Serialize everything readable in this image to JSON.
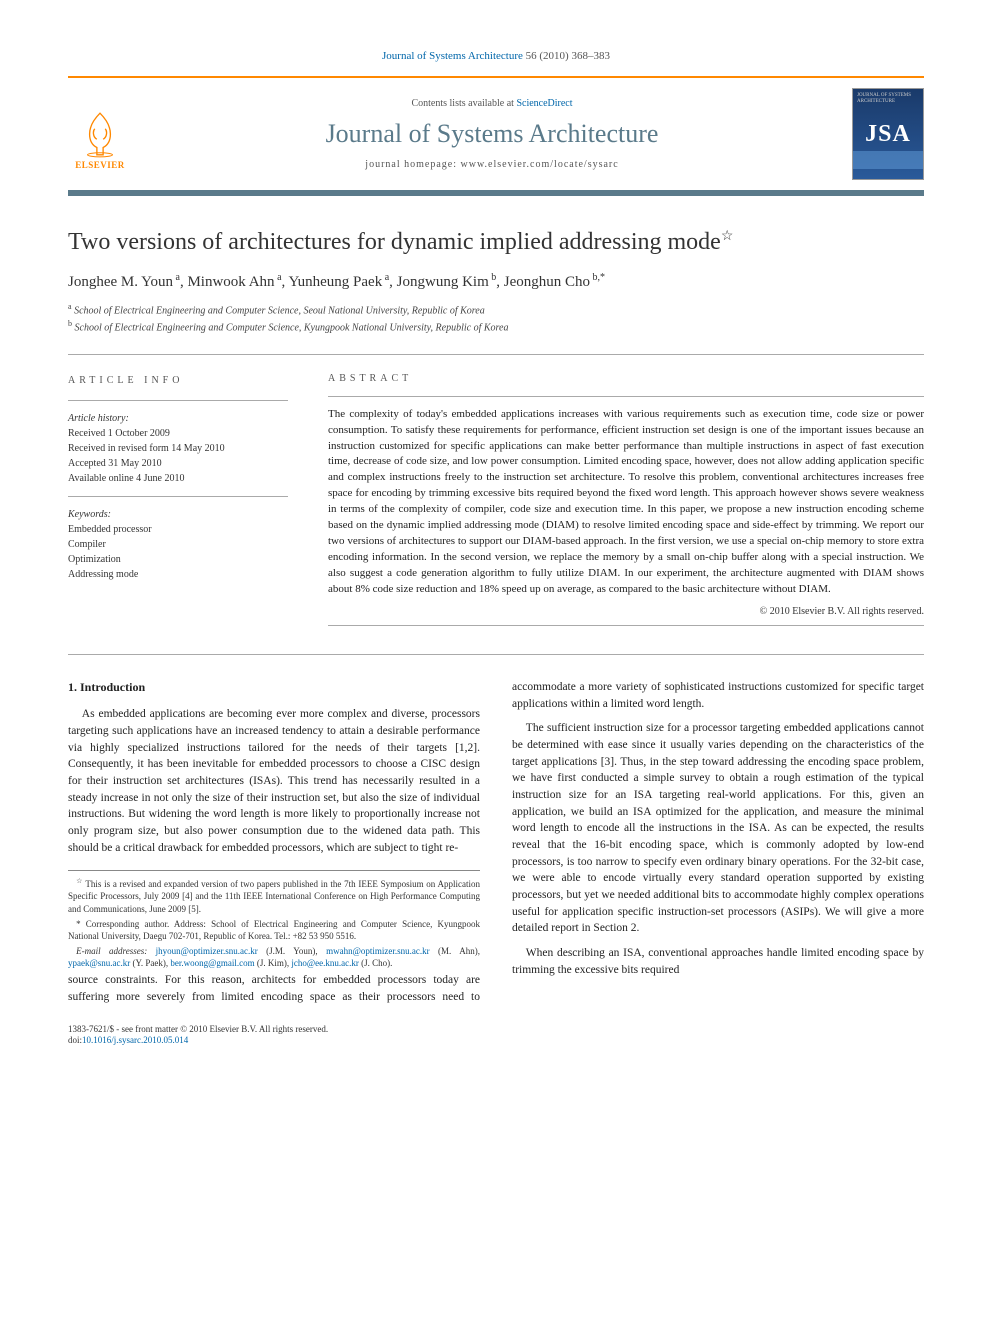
{
  "top_citation": {
    "journal_link": "Journal of Systems Architecture",
    "vol_pages": " 56 (2010) 368–383"
  },
  "mast": {
    "contents_prefix": "Contents lists available at ",
    "contents_link": "ScienceDirect",
    "journal_name": "Journal of Systems Architecture",
    "homepage_prefix": "journal homepage: ",
    "homepage_url": "www.elsevier.com/locate/sysarc",
    "logo_text": "ELSEVIER",
    "cover_label": "JSA",
    "cover_top": "JOURNAL OF SYSTEMS ARCHITECTURE"
  },
  "title": "Two versions of architectures for dynamic implied addressing mode",
  "title_star": "☆",
  "authors_html": "Jonghee M. Youn ᵃ, Minwook Ahn ᵃ, Yunheung Paek ᵃ, Jongwung Kim ᵇ, Jeonghun Cho ᵇ,*",
  "affils": {
    "a": "School of Electrical Engineering and Computer Science, Seoul National University, Republic of Korea",
    "b": "School of Electrical Engineering and Computer Science, Kyungpook National University, Republic of Korea"
  },
  "info": {
    "heading": "ARTICLE INFO",
    "history_label": "Article history:",
    "received": "Received 1 October 2009",
    "revised": "Received in revised form 14 May 2010",
    "accepted": "Accepted 31 May 2010",
    "online": "Available online 4 June 2010",
    "keywords_label": "Keywords:",
    "keywords": [
      "Embedded processor",
      "Compiler",
      "Optimization",
      "Addressing mode"
    ]
  },
  "abstract": {
    "heading": "ABSTRACT",
    "text": "The complexity of today's embedded applications increases with various requirements such as execution time, code size or power consumption. To satisfy these requirements for performance, efficient instruction set design is one of the important issues because an instruction customized for specific applications can make better performance than multiple instructions in aspect of fast execution time, decrease of code size, and low power consumption. Limited encoding space, however, does not allow adding application specific and complex instructions freely to the instruction set architecture. To resolve this problem, conventional architectures increases free space for encoding by trimming excessive bits required beyond the fixed word length. This approach however shows severe weakness in terms of the complexity of compiler, code size and execution time. In this paper, we propose a new instruction encoding scheme based on the dynamic implied addressing mode (DIAM) to resolve limited encoding space and side-effect by trimming. We report our two versions of architectures to support our DIAM-based approach. In the first version, we use a special on-chip memory to store extra encoding information. In the second version, we replace the memory by a small on-chip buffer along with a special instruction. We also suggest a code generation algorithm to fully utilize DIAM. In our experiment, the architecture augmented with DIAM shows about 8% code size reduction and 18% speed up on average, as compared to the basic architecture without DIAM.",
    "copyright": "© 2010 Elsevier B.V. All rights reserved."
  },
  "body": {
    "section_heading": "1. Introduction",
    "p1": "As embedded applications are becoming ever more complex and diverse, processors targeting such applications have an increased tendency to attain a desirable performance via highly specialized instructions tailored for the needs of their targets [1,2]. Consequently, it has been inevitable for embedded processors to choose a CISC design for their instruction set architectures (ISAs). This trend has necessarily resulted in a steady increase in not only the size of their instruction set, but also the size of individual instructions. But widening the word length is more likely to proportionally increase not only program size, but also power consumption due to the widened data path. This should be a critical drawback for embedded processors, which are subject to tight re-",
    "p2": "source constraints. For this reason, architects for embedded processors today are suffering more severely from limited encoding space as their processors need to accommodate a more variety of sophisticated instructions customized for specific target applications within a limited word length.",
    "p3": "The sufficient instruction size for a processor targeting embedded applications cannot be determined with ease since it usually varies depending on the characteristics of the target applications [3]. Thus, in the step toward addressing the encoding space problem, we have first conducted a simple survey to obtain a rough estimation of the typical instruction size for an ISA targeting real-world applications. For this, given an application, we build an ISA optimized for the application, and measure the minimal word length to encode all the instructions in the ISA. As can be expected, the results reveal that the 16-bit encoding space, which is commonly adopted by low-end processors, is too narrow to specify even ordinary binary operations. For the 32-bit case, we were able to encode virtually every standard operation supported by existing processors, but yet we needed additional bits to accommodate highly complex operations useful for application specific instruction-set processors (ASIPs). We will give a more detailed report in Section 2.",
    "p4": "When describing an ISA, conventional approaches handle limited encoding space by trimming the excessive bits required"
  },
  "footnotes": {
    "star": "This is a revised and expanded version of two papers published in the 7th IEEE Symposium on Application Specific Processors, July 2009 [4] and the 11th IEEE International Conference on High Performance Computing and Communications, June 2009 [5].",
    "corr": "Corresponding author. Address: School of Electrical Engineering and Computer Science, Kyungpook National University, Daegu 702-701, Republic of Korea. Tel.: +82 53 950 5516.",
    "emails_label": "E-mail addresses: ",
    "emails": [
      {
        "addr": "jhyoun@optimizer.snu.ac.kr",
        "who": " (J.M. Youn), "
      },
      {
        "addr": "mwahn@optimizer.snu.ac.kr",
        "who": " (M. Ahn), "
      },
      {
        "addr": "ypaek@snu.ac.kr",
        "who": " (Y. Paek), "
      },
      {
        "addr": "ber.woong@gmail.com",
        "who": " (J. Kim), "
      },
      {
        "addr": "jcho@ee.knu.ac.kr",
        "who": " (J. Cho)."
      }
    ]
  },
  "bottom": {
    "line1": "1383-7621/$ - see front matter © 2010 Elsevier B.V. All rights reserved.",
    "doi_prefix": "doi:",
    "doi": "10.1016/j.sysarc.2010.05.014"
  }
}
